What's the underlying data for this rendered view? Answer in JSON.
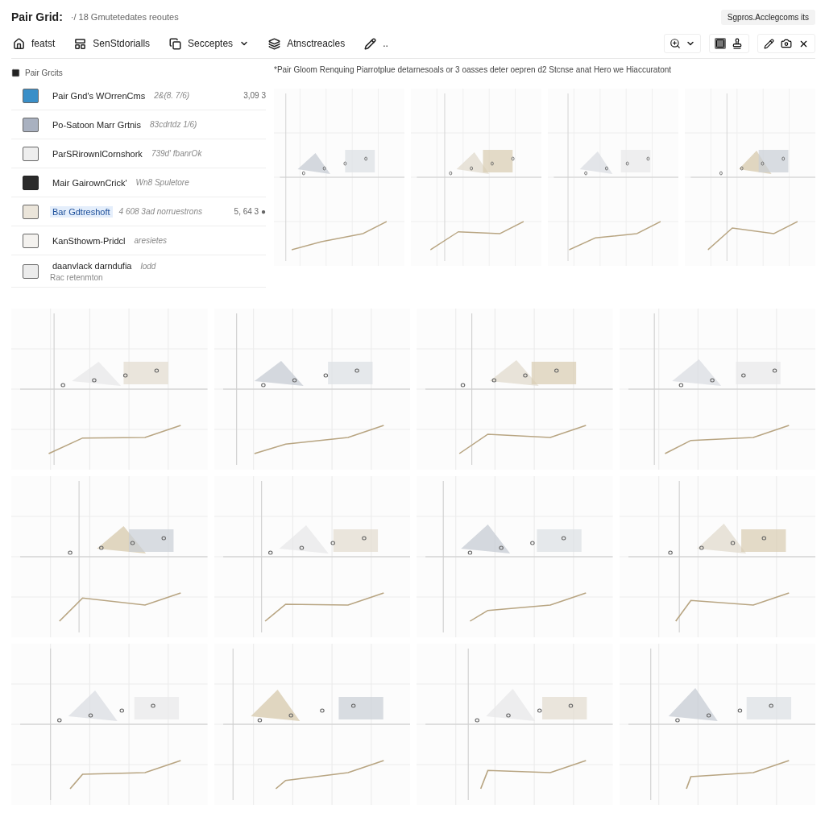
{
  "header": {
    "title": "Pair Grid:",
    "subtitle": "·/ 18 Gmutetedates reoutes",
    "badge": "Sgpros.Acclegcoms its"
  },
  "toolbar": [
    {
      "kind": "home",
      "label": "featst"
    },
    {
      "kind": "grid",
      "label": "SenStdorialls"
    },
    {
      "kind": "dropdown",
      "label": "Secceptes"
    },
    {
      "kind": "stack",
      "label": "Atnsctreacles"
    },
    {
      "kind": "pencil",
      "label": ".."
    }
  ],
  "sidebar": {
    "title": "Pair Grcits",
    "items": [
      {
        "title": "Pair Gnd's WOrrenCms",
        "note": "2&(8. 7/6)",
        "value": "3,09 3",
        "color": "#3a8fc8",
        "selected": false
      },
      {
        "title": "Po-Satoon Marr Grtnis",
        "note": "83cdrtdz 1/6)",
        "color": "#a9b1c0",
        "selected": false
      },
      {
        "title": "ParSRirownlCornshork",
        "note": "739d' fbanrOk",
        "color": "#eeeeee",
        "selected": false
      },
      {
        "title": "Mair GairownCrick'",
        "note": "Wn8 Spuletore",
        "color": "#2b2b2b",
        "selected": false
      },
      {
        "title": "Bar Gdtreshoft",
        "note": "4 608 3ad norruestrons",
        "value": "5, 64 3 ●",
        "color": "#ebe5da",
        "selected": true
      },
      {
        "title": "KanSthowm-Pridcl",
        "note": "aresietes",
        "color": "#f4f2ef",
        "selected": false
      },
      {
        "title": "daanvlack darndufia",
        "note": "lodd",
        "subline": "Rac retenmton",
        "color": "#ececec",
        "selected": false
      }
    ]
  },
  "caption": "*Pair Gloom Renquing Piarrotplue detarnesoals or 3 oasses deter oepren d2 Stcnse anat Hero we Hiaccuratont"
}
